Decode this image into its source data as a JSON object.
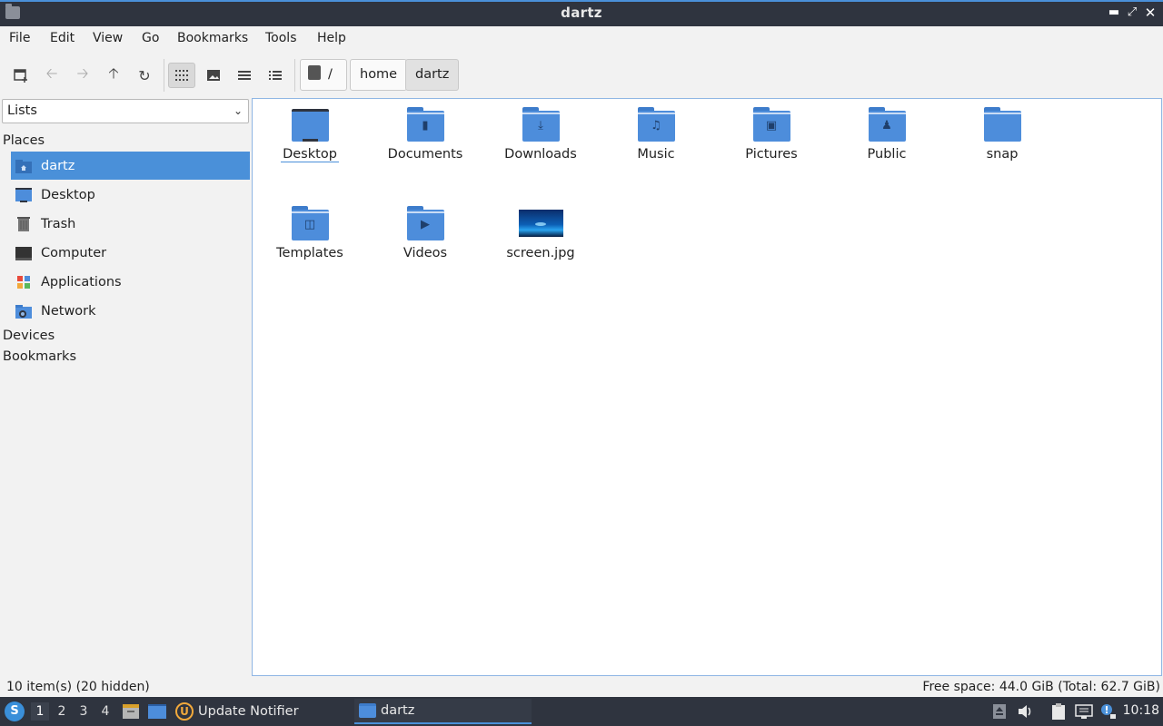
{
  "window": {
    "title": "dartz"
  },
  "menu": [
    "File",
    "Edit",
    "View",
    "Go",
    "Bookmarks",
    "Tools",
    "Help"
  ],
  "breadcrumb": {
    "root": "/",
    "parts": [
      "home",
      "dartz"
    ]
  },
  "sidebar": {
    "dropdown": "Lists",
    "places_title": "Places",
    "places": [
      {
        "label": "dartz",
        "icon": "home-folder-icon"
      },
      {
        "label": "Desktop",
        "icon": "desktop-icon"
      },
      {
        "label": "Trash",
        "icon": "trash-icon"
      },
      {
        "label": "Computer",
        "icon": "computer-icon"
      },
      {
        "label": "Applications",
        "icon": "applications-icon"
      },
      {
        "label": "Network",
        "icon": "network-icon"
      }
    ],
    "devices_title": "Devices",
    "bookmarks_title": "Bookmarks"
  },
  "files": [
    {
      "name": "Desktop",
      "type": "desktop"
    },
    {
      "name": "Documents",
      "type": "folder",
      "emblem": "document"
    },
    {
      "name": "Downloads",
      "type": "folder",
      "emblem": "download"
    },
    {
      "name": "Music",
      "type": "folder",
      "emblem": "music"
    },
    {
      "name": "Pictures",
      "type": "folder",
      "emblem": "picture"
    },
    {
      "name": "Public",
      "type": "folder",
      "emblem": "user"
    },
    {
      "name": "snap",
      "type": "folder",
      "emblem": ""
    },
    {
      "name": "Templates",
      "type": "folder",
      "emblem": "template"
    },
    {
      "name": "Videos",
      "type": "folder",
      "emblem": "video"
    },
    {
      "name": "screen.jpg",
      "type": "image"
    }
  ],
  "status": {
    "items": "10 item(s) (20 hidden)",
    "free": "Free space: 44.0 GiB (Total: 62.7 GiB)"
  },
  "panel": {
    "workspaces": [
      "1",
      "2",
      "3",
      "4"
    ],
    "tasks": [
      {
        "label": "Update Notifier"
      },
      {
        "label": "dartz"
      }
    ],
    "clock": "10:18"
  },
  "colors": {
    "accent": "#4a90d9",
    "folder": "#4d8ddb",
    "panel": "#2f343f"
  }
}
